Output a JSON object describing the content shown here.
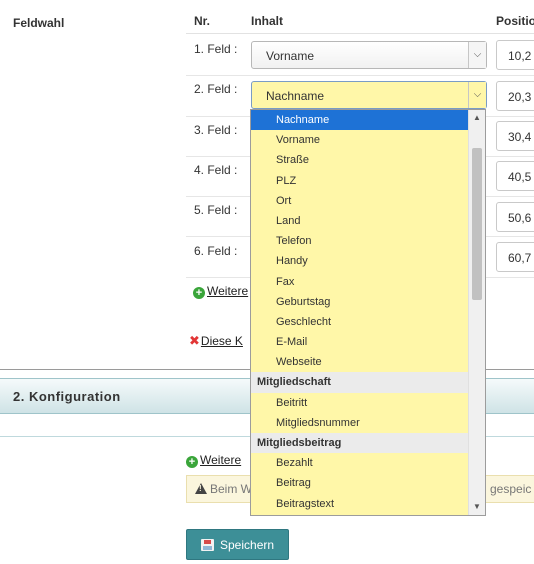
{
  "section1": {
    "label": "Feldwahl",
    "col_nr": "Nr.",
    "col_inhalt": "Inhalt",
    "col_position": "Positio",
    "rows": [
      {
        "label": "1. Feld :",
        "value": "Vorname",
        "position": "10,2"
      },
      {
        "label": "2. Feld :",
        "value": "Nachname",
        "position": "20,3"
      },
      {
        "label": "3. Feld :",
        "position": "30,4"
      },
      {
        "label": "4. Feld :",
        "position": "40,5"
      },
      {
        "label": "5. Feld :",
        "position": "50,6"
      },
      {
        "label": "6. Feld :",
        "position": "60,7"
      }
    ],
    "add_field_link": "Weitere",
    "delete_link": "Diese K"
  },
  "section2": {
    "title": "2. Konfiguration",
    "add_link": "Weitere",
    "warning_text": "Beim W",
    "warning_tail": "gespeic",
    "save_label": "Speichern"
  },
  "dropdown": {
    "items": [
      {
        "type": "option",
        "label": "Nachname",
        "selected": true
      },
      {
        "type": "option",
        "label": "Vorname"
      },
      {
        "type": "option",
        "label": "Straße"
      },
      {
        "type": "option",
        "label": "PLZ"
      },
      {
        "type": "option",
        "label": "Ort"
      },
      {
        "type": "option",
        "label": "Land"
      },
      {
        "type": "option",
        "label": "Telefon"
      },
      {
        "type": "option",
        "label": "Handy"
      },
      {
        "type": "option",
        "label": "Fax"
      },
      {
        "type": "option",
        "label": "Geburtstag"
      },
      {
        "type": "option",
        "label": "Geschlecht"
      },
      {
        "type": "option",
        "label": "E-Mail"
      },
      {
        "type": "option",
        "label": "Webseite"
      },
      {
        "type": "group",
        "label": "Mitgliedschaft"
      },
      {
        "type": "option",
        "label": "Beitritt"
      },
      {
        "type": "option",
        "label": "Mitgliedsnummer"
      },
      {
        "type": "group",
        "label": "Mitgliedsbeitrag"
      },
      {
        "type": "option",
        "label": "Bezahlt"
      },
      {
        "type": "option",
        "label": "Beitrag"
      },
      {
        "type": "option",
        "label": "Beitragstext"
      }
    ]
  },
  "colors": {
    "dropdown_bg": "#fff7a8",
    "selected_bg": "#1e72d6",
    "save_button": "#3d8f97",
    "section_header": "#cfe3e6"
  },
  "icons": {
    "add": "plus-circle-icon",
    "delete": "x-icon",
    "warning": "warning-icon",
    "save": "floppy-disk-icon",
    "select_arrow": "chevron-down-icon"
  }
}
